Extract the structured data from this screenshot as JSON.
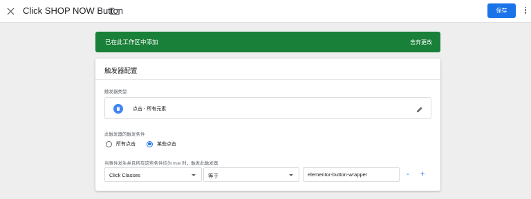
{
  "header": {
    "title": "Click SHOP NOW Button",
    "close_icon": "close-icon",
    "folder_icon": "folder-icon",
    "save_label": "保存",
    "more_icon": "more-vert-icon"
  },
  "banner": {
    "message": "已在此工作区中添加",
    "discard_label": "舍弃更改",
    "color": "#188038"
  },
  "trigger_config": {
    "title": "触发器配置",
    "type_label": "触发器类型",
    "type_value": "点击 - 所有元素",
    "type_icon": "click-cursor-icon",
    "edit_icon": "pencil-icon",
    "fires_on_label": "此触发器的触发条件",
    "fires_on_options": [
      {
        "label": "所有点击",
        "selected": false
      },
      {
        "label": "某些点击",
        "selected": true
      }
    ],
    "condition_label": "当事件发生并且所有这些条件均为 true 时，触发此触发器",
    "condition": {
      "variable": "Click Classes",
      "operator": "等于",
      "value": "elementor-button-wrapper"
    },
    "remove_label": "-",
    "add_label": "+"
  },
  "colors": {
    "accent": "#1a73e8",
    "success": "#188038"
  }
}
